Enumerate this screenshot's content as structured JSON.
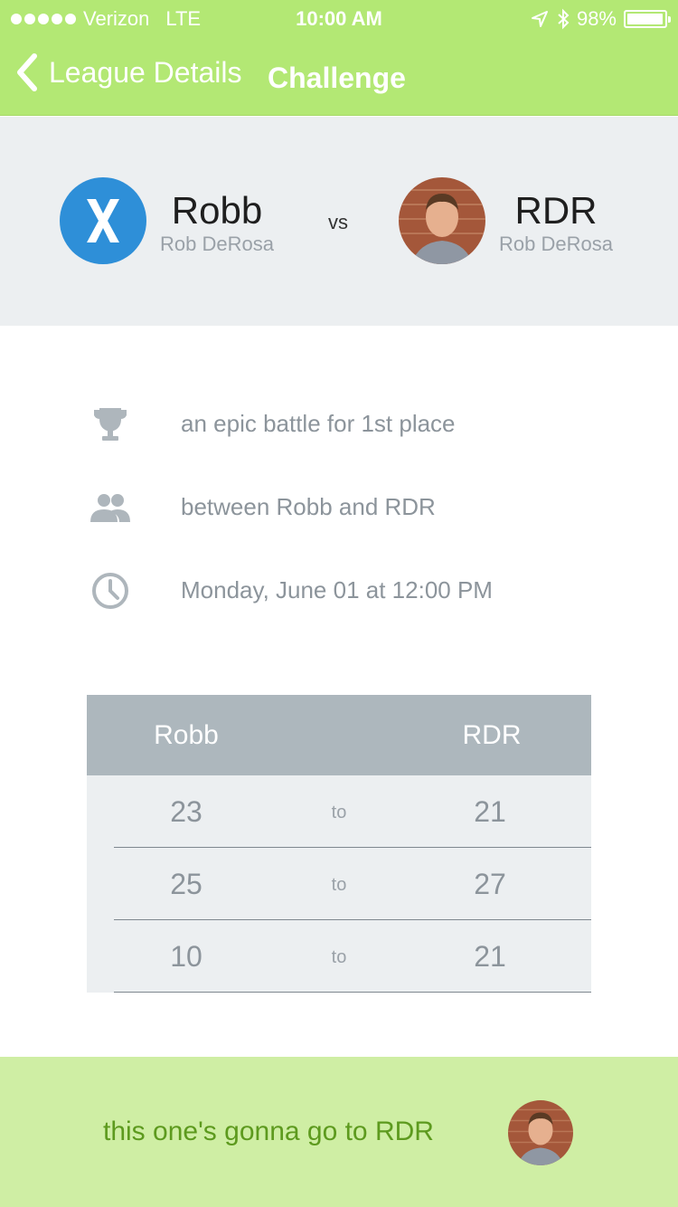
{
  "status_bar": {
    "carrier": "Verizon",
    "network": "LTE",
    "time": "10:00 AM",
    "battery_text": "98%",
    "battery_level": 0.98
  },
  "nav": {
    "back_label": "League Details",
    "title": "Challenge"
  },
  "players": {
    "left": {
      "name": "Robb",
      "subtitle": "Rob DeRosa"
    },
    "vs_label": "vs",
    "right": {
      "name": "RDR",
      "subtitle": "Rob DeRosa"
    }
  },
  "details": [
    {
      "icon": "trophy-icon",
      "text": "an epic battle for 1st place"
    },
    {
      "icon": "group-icon",
      "text": "between Robb and RDR"
    },
    {
      "icon": "clock-icon",
      "text": "Monday, June 01 at 12:00 PM"
    }
  ],
  "score_table": {
    "headers": [
      "Robb",
      "RDR"
    ],
    "rows": [
      {
        "left": "23",
        "sep": "to",
        "right": "21"
      },
      {
        "left": "25",
        "sep": "to",
        "right": "27"
      },
      {
        "left": "10",
        "sep": "to",
        "right": "21"
      }
    ]
  },
  "footer": {
    "message": "this one's gonna go to RDR"
  },
  "colors": {
    "nav_bg": "#b3e874",
    "header_bg": "#eceff1",
    "table_header_bg": "#adb7bd",
    "footer_bg": "#cfeea4",
    "footer_text": "#5d9a1e",
    "avatar_blue": "#2e8fd8"
  }
}
